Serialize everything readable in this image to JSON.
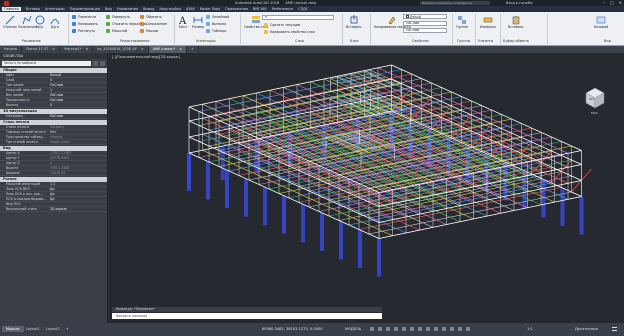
{
  "title_bar": {
    "app_title": "Autodesk AutoCAD 2016",
    "file_name": "AMK (ниже).dwg",
    "search_placeholder": "Введите ключевое слово/фразу",
    "user": "Вход в службы",
    "minimize": "–",
    "maximize": "□",
    "close": "✕"
  },
  "menu_tabs": [
    "Главная",
    "Вставка",
    "Аннотации",
    "Параметризация",
    "Вид",
    "Управление",
    "Вывод",
    "Надстройки",
    "A360",
    "Raster Tools",
    "Приложения",
    "BIM 360",
    "Performance",
    "СПДС"
  ],
  "active_menu_tab": "Главная",
  "ribbon": {
    "draw_group": {
      "label": "Рисование",
      "tools": [
        "Отрезок",
        "Полилиния",
        "Круг",
        "Дуга"
      ]
    },
    "modify_group": {
      "label": "Редактирование",
      "rows": [
        [
          "Перенести",
          "Повернуть",
          "Обрезать"
        ],
        [
          "Копировать",
          "Отразить зеркально",
          "Сопряжение"
        ],
        [
          "Растянуть",
          "Масштаб",
          "Массив"
        ]
      ]
    },
    "annotation_group": {
      "label": "Аннотации",
      "text_tool": "Текст",
      "dim_tool": "Размер",
      "rows": [
        "Линейный",
        "Выноска",
        "Таблица"
      ]
    },
    "layers_group": {
      "label": "Слои",
      "properties_tool": "Свойства слоя",
      "layer_combo": "0",
      "rows": [
        "Сделать текущим",
        "Копировать свойства слоя"
      ]
    },
    "block_group": {
      "label": "Блок",
      "insert_tool": "Вставить"
    },
    "properties_group": {
      "label": "Свойства",
      "copy_props_tool": "Копирование свойств",
      "color_combo": "Белый",
      "linetype_combo": "ПоСлою",
      "lineweight_combo": "ПоСлою"
    },
    "groups_group": {
      "label": "Группы",
      "tool": "Группа"
    },
    "utilities_group": {
      "label": "Утилиты",
      "tool": "Измерить"
    },
    "clipboard_group": {
      "label": "Буфер обмена",
      "tool": "Вставить"
    },
    "view_group": {
      "label": "Вид",
      "tool": "Базовый"
    }
  },
  "file_tabs": [
    "Начало",
    "Листы 51-57",
    "Чертеж1*",
    "ак_20160816_1038_AP",
    "AMK (ниже)*"
  ],
  "active_file_tab": "AMK (ниже)*",
  "viewport_label": "[-][Пользовательский вид][2D-каркас]",
  "properties_palette": {
    "title": "СВОЙСТВА",
    "selection": "Ничего не выбрано",
    "sections": [
      {
        "name": "Общие",
        "rows": [
          {
            "key": "Цвет",
            "value": "Белый",
            "dim": false
          },
          {
            "key": "Слой",
            "value": "0",
            "dim": false
          },
          {
            "key": "Тип линий",
            "value": "ПоСлою",
            "dim": false
          },
          {
            "key": "Масштаб типа линий",
            "value": "1",
            "dim": false
          },
          {
            "key": "Вес линий",
            "value": "ПоСлою",
            "dim": false
          },
          {
            "key": "Прозрачность",
            "value": "ПоСлою",
            "dim": false
          },
          {
            "key": "Высота",
            "value": "0",
            "dim": false
          }
        ]
      },
      {
        "name": "3D-визуализация",
        "rows": [
          {
            "key": "Материал",
            "value": "ПоСлою",
            "dim": false
          }
        ]
      },
      {
        "name": "Стиль печати",
        "rows": [
          {
            "key": "Стиль печати",
            "value": "ПоЦвету",
            "dim": true
          },
          {
            "key": "Таблица стилей печати",
            "value": "Нет",
            "dim": false
          },
          {
            "key": "Пространство таблиц...",
            "value": "Модель",
            "dim": true
          },
          {
            "key": "Тип стилей печати",
            "value": "Недоступно",
            "dim": true
          }
        ]
      },
      {
        "name": "Вид",
        "rows": [
          {
            "key": "Центр X",
            "value": "170017.2287",
            "dim": true
          },
          {
            "key": "Центр Y",
            "value": "29778.9094",
            "dim": true
          },
          {
            "key": "Центр Z",
            "value": "0",
            "dim": true
          },
          {
            "key": "Высота",
            "value": "35901.3488",
            "dim": true
          },
          {
            "key": "Ширина",
            "value": "11019.59",
            "dim": true
          }
        ]
      },
      {
        "name": "Разное",
        "rows": [
          {
            "key": "Масштаб аннотаций",
            "value": "1:1",
            "dim": false
          },
          {
            "key": "Знак ПСК ВКЛ",
            "value": "Да",
            "dim": false
          },
          {
            "key": "Знак ПСК в нач. коо...",
            "value": "Да",
            "dim": false
          },
          {
            "key": "ПСК в каждом Видово...",
            "value": "Да",
            "dim": false
          },
          {
            "key": "Имя ПСК",
            "value": "",
            "dim": false
          },
          {
            "key": "Визуальный стиль",
            "value": "2D-каркас",
            "dim": false
          }
        ]
      }
    ]
  },
  "command_line": {
    "history": "Команда: *Прервано*",
    "placeholder": "Введите команду"
  },
  "status_bar": {
    "layout_tabs": [
      "Модель",
      "Layout1",
      "Layout2"
    ],
    "active_layout": "Модель",
    "add_tab": "+",
    "coordinates": "60080.3481, 36103.1275, 0.0000",
    "mode": "МОДЕЛЬ",
    "scale": "1:1",
    "units": "Десятичные"
  },
  "viewcube": {
    "label": "ЮЗ",
    "wcs": "МСК"
  },
  "colors": {
    "background": "#262a30",
    "ribbon": "#eef0f3",
    "panel": "#3a3f47",
    "accent": "#e23b2e"
  }
}
